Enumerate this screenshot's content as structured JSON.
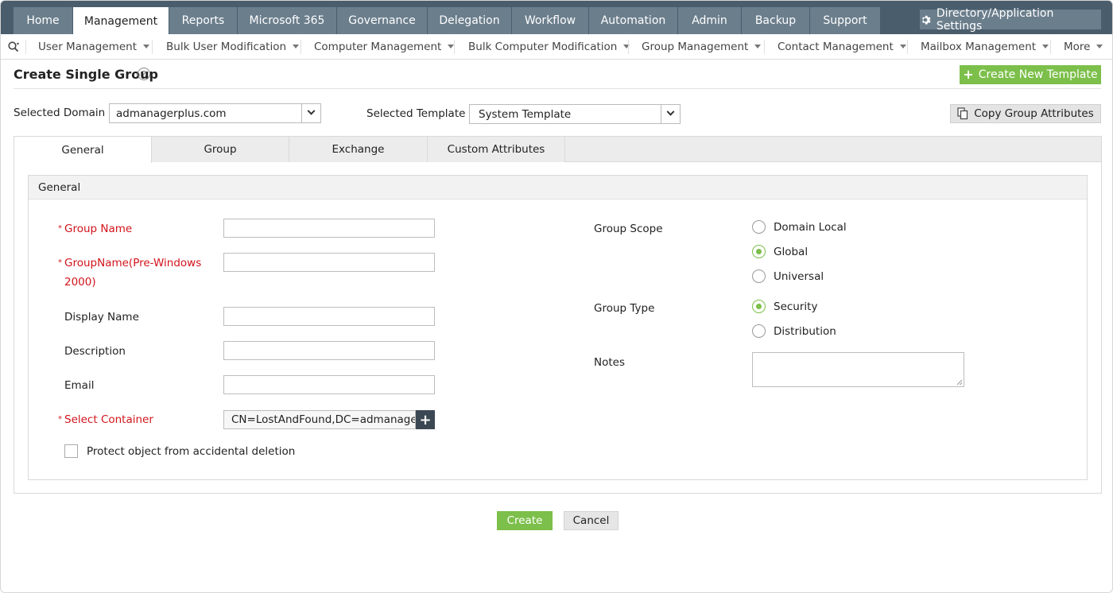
{
  "topnav": {
    "tabs": [
      "Home",
      "Management",
      "Reports",
      "Microsoft 365",
      "Governance",
      "Delegation",
      "Workflow",
      "Automation",
      "Admin",
      "Backup",
      "Support"
    ],
    "active_tab": "Management",
    "settings_label": "Directory/Application Settings"
  },
  "subnav": {
    "items": [
      "User Management",
      "Bulk User Modification",
      "Computer Management",
      "Bulk Computer Modification",
      "Group Management",
      "Contact Management",
      "Mailbox Management",
      "More"
    ]
  },
  "page": {
    "title": "Create Single Group",
    "create_template_label": "Create New Template",
    "domain_label": "Selected Domain",
    "domain_value": "admanagerplus.com",
    "template_label": "Selected Template",
    "template_value": "System Template",
    "copy_attributes_label": "Copy Group Attributes"
  },
  "form_tabs": [
    "General",
    "Group",
    "Exchange",
    "Custom Attributes"
  ],
  "active_form_tab": "General",
  "section": {
    "title": "General",
    "group_name_label": "Group Name",
    "prewin_label_1": "GroupName(Pre-Windows",
    "prewin_label_2": "2000)",
    "display_name_label": "Display Name",
    "description_label": "Description",
    "email_label": "Email",
    "container_label": "Select Container",
    "container_value": "CN=LostAndFound,DC=admanagerp",
    "protect_label": "Protect object from accidental deletion",
    "group_scope_label": "Group Scope",
    "scope_options": [
      "Domain Local",
      "Global",
      "Universal"
    ],
    "scope_selected": "Global",
    "group_type_label": "Group Type",
    "type_options": [
      "Security",
      "Distribution"
    ],
    "type_selected": "Security",
    "notes_label": "Notes"
  },
  "actions": {
    "create_label": "Create",
    "cancel_label": "Cancel"
  },
  "colors": {
    "nav_bg": "#4a5d6c",
    "nav_tab": "#6b7e8c",
    "accent_green": "#7cbf4a",
    "required_red": "#d2141b"
  }
}
